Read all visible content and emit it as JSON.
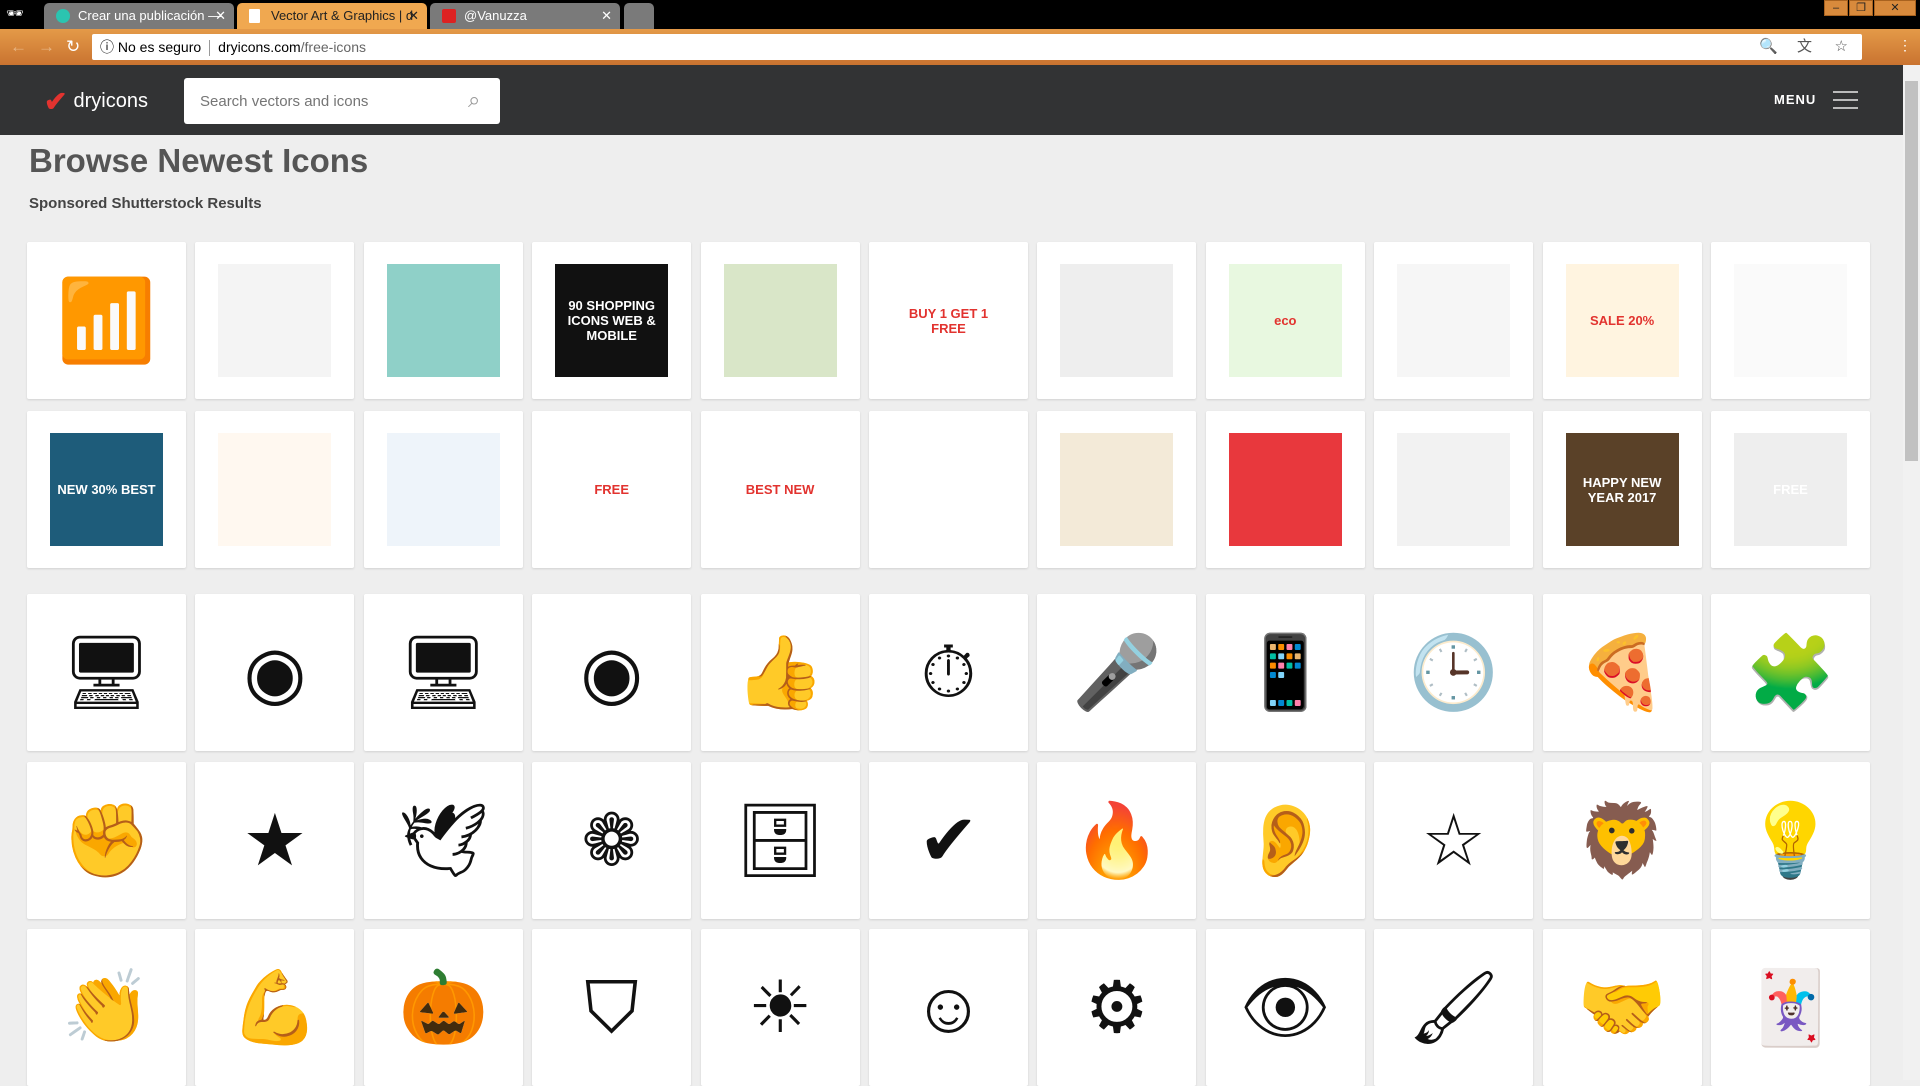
{
  "browser": {
    "tabs": [
      {
        "title": "Crear una publicación —",
        "icon": "circle-logo-icon",
        "active": false
      },
      {
        "title": "Vector Art & Graphics | d",
        "icon": "document-icon",
        "active": true
      },
      {
        "title": "@Vanuzza",
        "icon": "calendar-icon",
        "active": false
      }
    ],
    "security": "No es seguro",
    "domain": "dryicons.com",
    "path": "/free-icons"
  },
  "site": {
    "logo": "dryicons",
    "search_placeholder": "Search vectors and icons",
    "menu_label": "MENU",
    "title": "Browse Newest Icons",
    "sponsored_label": "Sponsored Shutterstock Results",
    "accent": "#e2332f"
  },
  "sponsored": [
    {
      "name": "wifi",
      "bg": "#ffffff",
      "text": ""
    },
    {
      "name": "icon-set-grey",
      "bg": "#f4f4f4",
      "text": ""
    },
    {
      "name": "badges-retro",
      "bg": "#8fd0c8",
      "text": ""
    },
    {
      "name": "shopping-icons",
      "bg": "#111111",
      "text": "90 SHOPPING ICONS WEB & MOBILE"
    },
    {
      "name": "stickers-green",
      "bg": "#d9e6c8",
      "text": ""
    },
    {
      "name": "buy-get-free",
      "bg": "#ffffff",
      "text": "BUY 1 GET 1 FREE"
    },
    {
      "name": "globes",
      "bg": "#eeeeee",
      "text": ""
    },
    {
      "name": "eco-labels",
      "bg": "#e8f8e0",
      "text": "eco"
    },
    {
      "name": "line-icons",
      "bg": "#f6f6f6",
      "text": ""
    },
    {
      "name": "sale-stickers",
      "bg": "#fff4e0",
      "text": "SALE 20%"
    },
    {
      "name": "outline-icons",
      "bg": "#fafafa",
      "text": ""
    },
    {
      "name": "price-badges",
      "bg": "#1e5c7a",
      "text": "NEW 30% BEST"
    },
    {
      "name": "colorful-buttons",
      "bg": "#fff8f0",
      "text": ""
    },
    {
      "name": "blue-line-icons",
      "bg": "#eef4fa",
      "text": ""
    },
    {
      "name": "free-burst",
      "bg": "#ffffff",
      "text": "FREE"
    },
    {
      "name": "red-arrow-stickers",
      "bg": "#ffffff",
      "text": "BEST NEW"
    },
    {
      "name": "paper-planes",
      "bg": "#ffffff",
      "text": ""
    },
    {
      "name": "red-ribbons",
      "bg": "#f3ead8",
      "text": ""
    },
    {
      "name": "people-group",
      "bg": "#e8383d",
      "text": ""
    },
    {
      "name": "no-gluten",
      "bg": "#f2f2f2",
      "text": ""
    },
    {
      "name": "happy-new-year-wood",
      "bg": "#5a4128",
      "text": "HAPPY NEW YEAR 2017"
    },
    {
      "name": "free-tag",
      "bg": "#eeeeee",
      "text": "FREE"
    }
  ],
  "icons": [
    {
      "name": "monitor",
      "glyph": "🖥"
    },
    {
      "name": "map-pin",
      "glyph": "◉"
    },
    {
      "name": "monitor",
      "glyph": "🖥"
    },
    {
      "name": "map-pin",
      "glyph": "◉"
    },
    {
      "name": "thumbs-up",
      "glyph": "👍"
    },
    {
      "name": "stopwatch",
      "glyph": "⏱"
    },
    {
      "name": "microphone",
      "glyph": "🎤"
    },
    {
      "name": "smartphone",
      "glyph": "📱"
    },
    {
      "name": "clock",
      "glyph": "🕒"
    },
    {
      "name": "pizza-slice",
      "glyph": "🍕"
    },
    {
      "name": "puzzle-piece",
      "glyph": "🧩"
    },
    {
      "name": "raised-fist",
      "glyph": "✊"
    },
    {
      "name": "star",
      "glyph": "★"
    },
    {
      "name": "dove",
      "glyph": "🕊"
    },
    {
      "name": "rose",
      "glyph": "❁"
    },
    {
      "name": "cabinet",
      "glyph": "🗄"
    },
    {
      "name": "checkmark",
      "glyph": "✔"
    },
    {
      "name": "flame",
      "glyph": "🔥"
    },
    {
      "name": "ear",
      "glyph": "👂"
    },
    {
      "name": "user-star",
      "glyph": "☆"
    },
    {
      "name": "lion",
      "glyph": "🦁"
    },
    {
      "name": "lightbulb",
      "glyph": "💡"
    },
    {
      "name": "clapping-hands",
      "glyph": "👏"
    },
    {
      "name": "flexed-bicep",
      "glyph": "💪"
    },
    {
      "name": "pumpkin",
      "glyph": "🎃"
    },
    {
      "name": "superman-shield",
      "glyph": "⛉"
    },
    {
      "name": "sun",
      "glyph": "☀"
    },
    {
      "name": "smiley",
      "glyph": "☺"
    },
    {
      "name": "gears",
      "glyph": "⚙"
    },
    {
      "name": "eye",
      "glyph": "👁"
    },
    {
      "name": "paintbrush",
      "glyph": "🖌"
    },
    {
      "name": "handshake",
      "glyph": "🤝"
    },
    {
      "name": "jester-hat",
      "glyph": "🃏"
    }
  ]
}
